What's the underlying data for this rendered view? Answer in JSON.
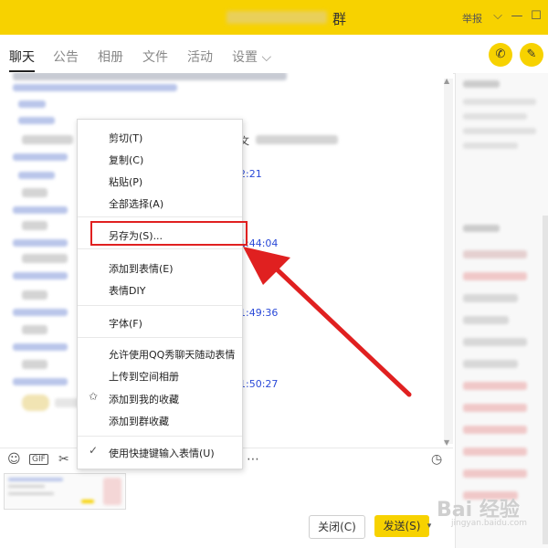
{
  "window": {
    "title_suffix": "群",
    "report_label": "举报",
    "collapse_glyph": "⌵",
    "minimize_glyph": "—",
    "maximize_glyph": "☐"
  },
  "tabs": [
    {
      "label": "聊天",
      "active": true
    },
    {
      "label": "公告"
    },
    {
      "label": "相册"
    },
    {
      "label": "文件"
    },
    {
      "label": "活动"
    },
    {
      "label": "设置 ⌵"
    }
  ],
  "header_buttons": {
    "phone_icon": "phone-icon",
    "phone_glyph": "✆",
    "chat_icon": "chat-add-icon",
    "chat_glyph": "✎"
  },
  "chat": {
    "timestamps": [
      "2:21",
      "1:44:04",
      "1:49:36",
      "1:50:27"
    ],
    "visible_fragment": "文",
    "scroll_up_glyph": "▲",
    "scroll_down_glyph": "▼"
  },
  "context_menu": {
    "items": [
      {
        "label": "剪切(T)"
      },
      {
        "label": "复制(C)"
      },
      {
        "label": "粘贴(P)"
      },
      {
        "label": "全部选择(A)"
      },
      {
        "label": "另存为(S)...",
        "highlighted": true
      },
      {
        "label": "添加到表情(E)"
      },
      {
        "label": "表情DIY"
      },
      {
        "label": "字体(F)"
      },
      {
        "label": "允许使用QQ秀聊天随动表情"
      },
      {
        "label": "上传到空间相册"
      },
      {
        "label": "添加到我的收藏",
        "icon": "favorite-star-icon"
      },
      {
        "label": "添加到群收藏"
      },
      {
        "label": "使用快捷键输入表情(U)",
        "icon": "checkmark-icon"
      }
    ],
    "star_glyph": "✩",
    "check_glyph": "✓"
  },
  "toolbar": {
    "emoji_glyph": "☺",
    "gif_label": "GIF",
    "scissors_glyph": "✂",
    "more_glyph": "⋯",
    "history_glyph": "◷"
  },
  "actions": {
    "close_label": "关闭(C)",
    "send_label": "发送(S)",
    "send_arrow_glyph": "▾"
  },
  "annotation": {
    "highlight_color": "#e02020"
  },
  "watermark": {
    "line1": "Bai 经验",
    "line2": "jingyan.baidu.com"
  },
  "colors": {
    "accent": "#f7d200",
    "link": "#2a49d8"
  }
}
